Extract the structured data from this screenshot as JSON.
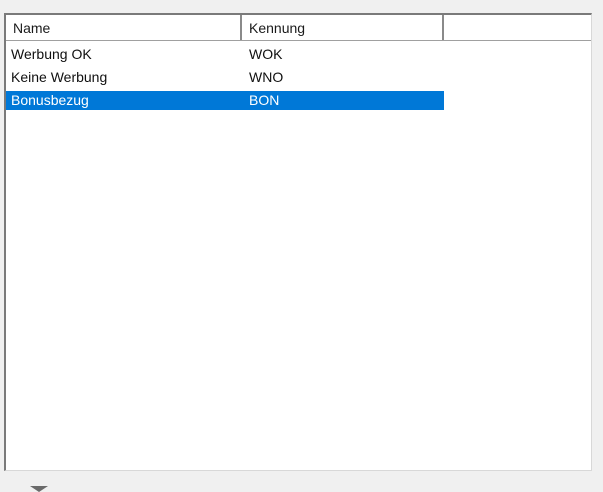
{
  "listview": {
    "columns": [
      {
        "label": "Name"
      },
      {
        "label": "Kennung"
      }
    ],
    "rows": [
      {
        "name": "Werbung OK",
        "kennung": "WOK",
        "selected": false
      },
      {
        "name": "Keine Werbung",
        "kennung": "WNO",
        "selected": false
      },
      {
        "name": "Bonusbezug",
        "kennung": "BON",
        "selected": true
      }
    ]
  },
  "colors": {
    "selection": "#0078d7",
    "background": "#f0f0f0"
  },
  "icons": {
    "bottom_indicator": "chevron-down-icon"
  }
}
